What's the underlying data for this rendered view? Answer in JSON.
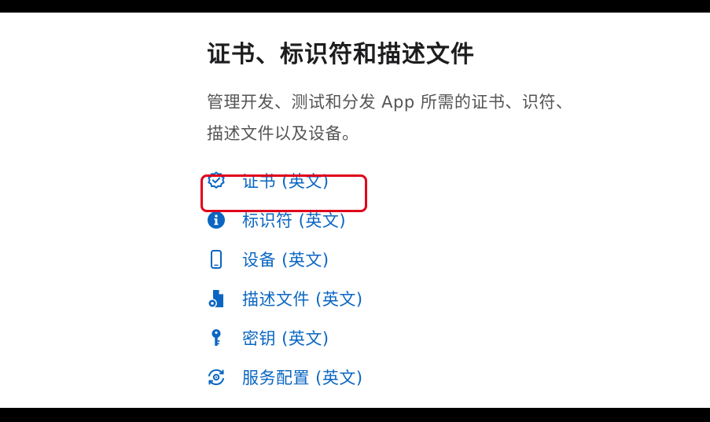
{
  "page": {
    "title": "证书、标识符和描述文件",
    "description": "管理开发、测试和分发 App 所需的证书、识符、描述文件以及设备。"
  },
  "links": [
    {
      "label": "证书 (英文)",
      "icon": "certificate-badge-icon"
    },
    {
      "label": "标识符 (英文)",
      "icon": "info-icon"
    },
    {
      "label": "设备 (英文)",
      "icon": "phone-icon"
    },
    {
      "label": "描述文件 (英文)",
      "icon": "profile-document-icon"
    },
    {
      "label": "密钥 (英文)",
      "icon": "key-icon"
    },
    {
      "label": "服务配置 (英文)",
      "icon": "service-sync-icon"
    }
  ],
  "colors": {
    "link": "#0a66c2",
    "highlight": "#e0001b",
    "title": "#1d1d1f",
    "description": "#555555"
  }
}
